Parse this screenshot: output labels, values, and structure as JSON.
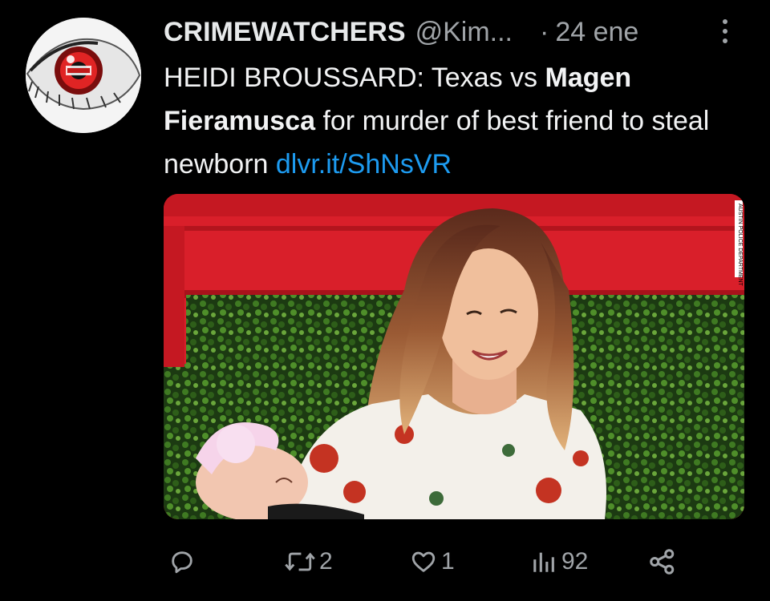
{
  "tweet": {
    "display_name": "CRIMEWATCHERS",
    "handle": "@Kim...",
    "separator": "·",
    "date": "24 ene",
    "text_part1": "HEIDI BROUSSARD: Texas vs ",
    "text_bold1": "Magen Fieramusca",
    "text_part2": " for murder of best friend to steal newborn ",
    "link": "dlvr.it/ShNsVR",
    "photo_credit": "AUSTIN POLICE DEPARTMENT"
  },
  "actions": {
    "reply_count": "",
    "retweet_count": "2",
    "like_count": "1",
    "views_count": "92"
  },
  "icons": {
    "avatar": "eye-logo-icon",
    "more": "more-vertical-icon",
    "reply": "reply-icon",
    "retweet": "retweet-icon",
    "like": "heart-icon",
    "views": "views-chart-icon",
    "share": "share-icon"
  },
  "colors": {
    "background": "#000000",
    "text": "#e7e9ea",
    "secondary": "#a0a4a8",
    "link": "#1d9bf0"
  }
}
